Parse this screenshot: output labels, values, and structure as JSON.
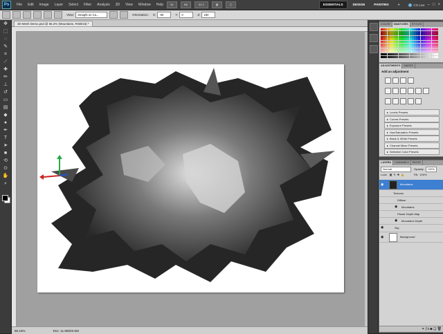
{
  "menubar": {
    "logo": "Ps",
    "items": [
      "File",
      "Edit",
      "Image",
      "Layer",
      "Select",
      "Filter",
      "Analysis",
      "3D",
      "View",
      "Window",
      "Help"
    ],
    "zoom_select": "50.2",
    "workspaces": [
      "ESSENTIALS",
      "DESIGN",
      "PAINTING"
    ],
    "more": "»",
    "search_label": "CS Live",
    "window_controls": [
      "–",
      "□",
      "×"
    ]
  },
  "options": {
    "view_label": "View:",
    "view_value": "Straight on Ca...",
    "orientation_label": "Orientation:",
    "x_label": "X:",
    "x_value": "-90",
    "y_label": "Y:",
    "y_value": "0",
    "z_label": "Z:",
    "z_value": "180"
  },
  "document": {
    "tab_title": "3D Mesh Demo.psd @ 66.2% (Mountains, RGB/16) *",
    "zoom": "66.16%",
    "info": "Doc: 11.8M/20.5M"
  },
  "panels": {
    "color_tabs": [
      "COLOR",
      "SWATCHES",
      "STYLES"
    ],
    "color_active": "SWATCHES",
    "adj_tabs": [
      "ADJUSTMENTS",
      "MASKS"
    ],
    "adj_active": "ADJUSTMENTS",
    "adj_title": "Add an adjustment",
    "presets": [
      "Levels Presets",
      "Curves Presets",
      "Exposure Presets",
      "Hue/Saturation Presets",
      "Black & White Presets",
      "Channel Mixer Presets",
      "Selective Color Presets"
    ],
    "layers_tabs": [
      "LAYERS",
      "CHANNELS",
      "PATHS"
    ],
    "layers_active": "LAYERS",
    "blend_mode": "Normal",
    "opacity_label": "Opacity:",
    "opacity_value": "100%",
    "lock_label": "Lock:",
    "fill_label": "Fill:",
    "fill_value": "100%",
    "layers": [
      {
        "name": "Mountains",
        "selected": true,
        "indent": 0
      },
      {
        "name": "Textures",
        "selected": false,
        "indent": 1
      },
      {
        "name": "Diffuse",
        "selected": false,
        "indent": 2
      },
      {
        "name": "Mountains",
        "selected": false,
        "indent": 3
      },
      {
        "name": "Planar Depth Map",
        "selected": false,
        "indent": 2
      },
      {
        "name": "Mountains Depth",
        "selected": false,
        "indent": 3
      },
      {
        "name": "Sky",
        "selected": false,
        "indent": 0
      },
      {
        "name": "Background",
        "selected": false,
        "indent": 0
      }
    ]
  },
  "colors": {
    "accent": "#3d7fd1",
    "workspace_bg": "#262626",
    "canvas_bg": "#ffffff",
    "axis_x": "#cc2222",
    "axis_y": "#22aa44",
    "axis_z": "#2255cc"
  },
  "icons": {
    "tools": [
      "move-icon",
      "marquee-icon",
      "lasso-icon",
      "quick-select-icon",
      "crop-icon",
      "eyedropper-icon",
      "healing-icon",
      "brush-icon",
      "clone-stamp-icon",
      "history-brush-icon",
      "eraser-icon",
      "gradient-icon",
      "blur-icon",
      "dodge-icon",
      "pen-icon",
      "type-icon",
      "path-select-icon",
      "shape-icon",
      "3d-rotate-icon",
      "3d-camera-icon",
      "hand-icon",
      "zoom-icon"
    ]
  }
}
